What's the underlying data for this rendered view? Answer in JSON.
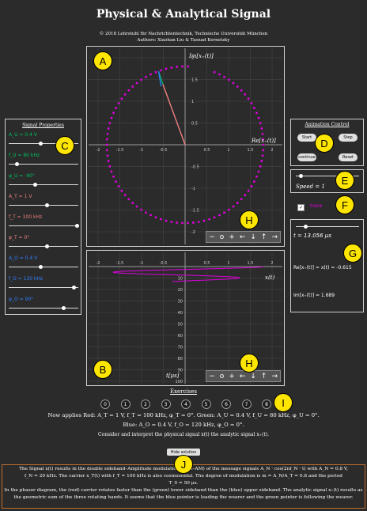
{
  "title": "Physical & Analytical Signal",
  "copyright": "© 2018 Lehrstuhl für Nachrichtentechnik, Technische Universität München",
  "authors": "Authors: Xiaohan Liu & Tasnad Kernetzky",
  "markers": [
    "A",
    "B",
    "C",
    "D",
    "E",
    "F",
    "G",
    "H",
    "H",
    "I",
    "J"
  ],
  "phasor_plot": {
    "y_label": "Im[x₊(t)]",
    "x_label": "Re[x₊(t)]",
    "x_ticks": [
      "-2",
      "-1.5",
      "-1",
      "-0.5",
      "0.5",
      "1",
      "1.5",
      "2"
    ],
    "y_ticks": [
      "2",
      "1.5",
      "1",
      "0.5",
      "-0.5",
      "-1",
      "-1.5",
      "-2"
    ],
    "trace_color": "#e000e0",
    "red_color": "#f08080",
    "green_color": "#00b060",
    "blue_color": "#3080ff"
  },
  "time_plot": {
    "x_label": "x(t)",
    "y_label": "t[μs]",
    "x_ticks": [
      "-2",
      "-1.5",
      "-1",
      "-0.5",
      "0.5",
      "1",
      "1.5",
      "2"
    ],
    "y_ticks": [
      "10",
      "20",
      "30",
      "40",
      "50",
      "60",
      "70",
      "80",
      "90",
      "100"
    ]
  },
  "graph_controls": [
    "−",
    "o",
    "+",
    "←",
    "↓",
    "↑",
    "→"
  ],
  "signal_properties": {
    "title": "Signal Properties",
    "items": [
      {
        "label": "A_U = 0.4 V",
        "color": "#00c060",
        "value": 0.45
      },
      {
        "label": "f_U = 80 kHz",
        "color": "#00c060",
        "value": 0.1
      },
      {
        "label": "φ_U = -90°",
        "color": "#00c060",
        "value": 0.37
      },
      {
        "label": "A_T = 1 V",
        "color": "#f08080",
        "value": 0.55
      },
      {
        "label": "f_T = 100 kHz",
        "color": "#f08080",
        "value": 1.0
      },
      {
        "label": "φ_T = 0°",
        "color": "#f08080",
        "value": 0.55
      },
      {
        "label": "A_O = 0.4 V",
        "color": "#3080ff",
        "value": 0.45
      },
      {
        "label": "f_O = 120 kHz",
        "color": "#3080ff",
        "value": 0.95
      },
      {
        "label": "φ_O = 90°",
        "color": "#3080ff",
        "value": 0.8
      }
    ]
  },
  "animation_control": {
    "title": "Animation Control",
    "start": "Start",
    "step": "Step",
    "continue": "continue",
    "reset": "Reset"
  },
  "speed": {
    "label": "Speed = 1",
    "value": 0.05
  },
  "trace": {
    "label": "trace",
    "checked": true
  },
  "info": {
    "time": "t = 13.056 μs",
    "re": "Re[x₊(t)] = x(t) = -0.615",
    "im": "Im[x₊(t)] = 1.689",
    "time_slider": 0.13
  },
  "exercises": {
    "title": "Exercises",
    "buttons": [
      "0",
      "1",
      "2",
      "3",
      "4",
      "5",
      "6",
      "7",
      "8"
    ],
    "applies": "Now applies Red: A_T = 1 V, f_T = 100 kHz, φ_T = 0°. Green: A_U = 0.4 V, f_U = 80 kHz, φ_U = 0°.",
    "applies2": "Blue: A_O = 0.4 V, f_O = 120 kHz, φ_O = 0°.",
    "consider": "Consider and interpret the physical signal x(t) the analytic signal x₊(t).",
    "hide": "Hide solution"
  },
  "solution": {
    "line1": "The Signal x(t) results in the double sideband–Amplitude modulation (DSB–AM) of the message signals A_N · cos(2πf_N · t) with A_N = 0.8 V,",
    "line2": "f_N = 20 kHz. The carrier x_T(t) with f_T = 100 kHz is also cosinusoidal. The degree of modulation is m = A_N/A_T = 0.8 and the period",
    "line3": "T_0 = 50 μs.",
    "line4": "In the phasor diagram, the (red) carrier rotates faster than the (green) lower sideband than the (blue) upper sideband. The analytic signal x₊(t) results as",
    "line5": "the geometric sum of the three rotating hands. It seems that the blue pointer is leading the wearer and the green pointer is following the wearer."
  }
}
